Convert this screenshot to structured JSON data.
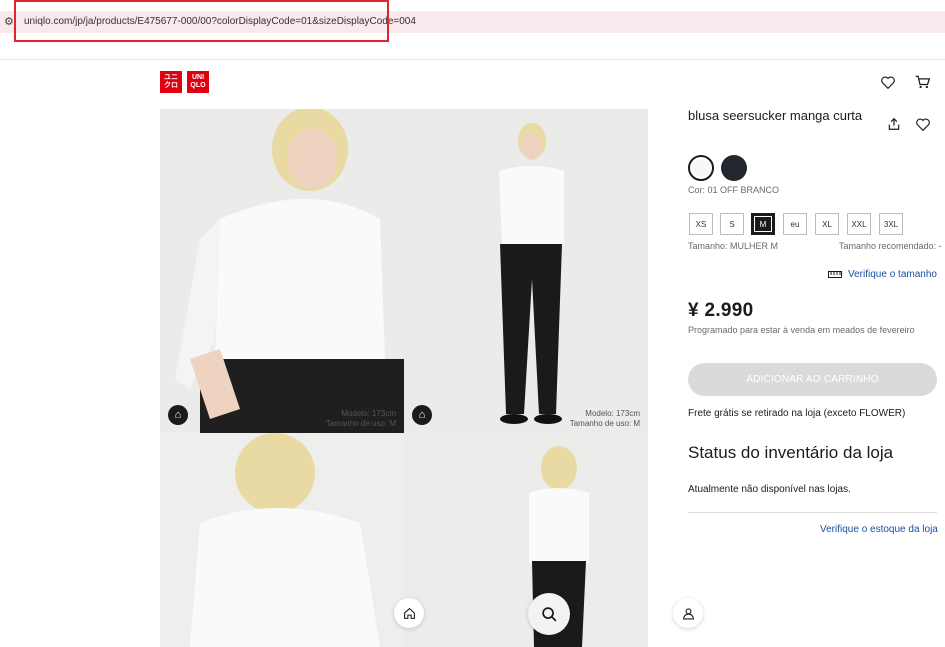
{
  "browser": {
    "url": "uniqlo.com/jp/ja/products/E475677-000/00?colorDisplayCode=01&sizeDisplayCode=004",
    "site_info_icon": "tune-icon"
  },
  "header": {
    "logo_text_top": "ユニ",
    "logo_text_bottom": "クロ",
    "logo_text_top_2": "UNI",
    "logo_text_bottom_2": "QLO"
  },
  "gallery": {
    "model_note_1": "Modelo: 173cm",
    "model_note_1b": "Tamanho de uso: M",
    "model_note_2": "Modelo: 173cm",
    "model_note_2b": "Tamanho de uso: M"
  },
  "product": {
    "title": "blusa seersucker manga curta",
    "color_label": "Cor: 01 OFF BRANCO",
    "sizes": [
      "XS",
      "S",
      "M",
      "eu",
      "XL",
      "XXL",
      "3XL"
    ],
    "selected_size": "M",
    "size_label": "Tamanho: MULHER M",
    "size_recommended": "Tamanho recomendado: -",
    "check_size_link": "Verifique o tamanho",
    "price": "¥ 2.990",
    "sale_note": "Programado para estar à venda em meados de fevereiro",
    "add_to_cart": "ADICIONAR AO CARRINHO",
    "shipping": "Frete grátis se retirado na loja (exceto FLOWER)",
    "inventory_title": "Status do inventário da loja",
    "inventory_status": "Atualmente não disponível nas lojas.",
    "inventory_link": "Verifique o estoque da loja"
  },
  "colors": {
    "brand_red": "#e00012",
    "swatch_white": "#f7f7f7",
    "swatch_navy": "#23262e",
    "link_blue": "#1a4f9c",
    "cart_disabled": "#dadada"
  }
}
